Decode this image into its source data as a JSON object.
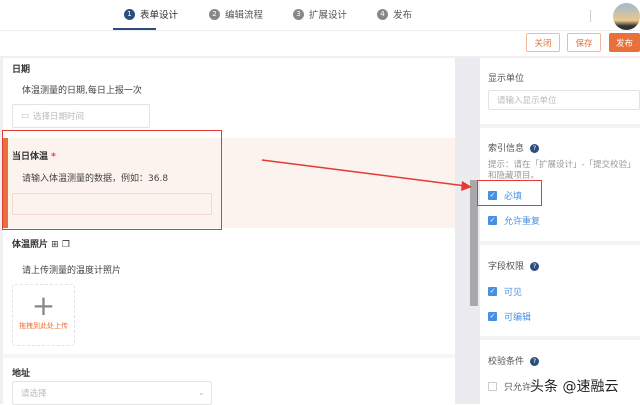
{
  "steps": [
    {
      "n": "1",
      "label": "表单设计"
    },
    {
      "n": "2",
      "label": "编辑流程"
    },
    {
      "n": "3",
      "label": "扩展设计"
    },
    {
      "n": "4",
      "label": "发布"
    }
  ],
  "toolbar": {
    "close": "关闭",
    "save": "保存",
    "publish": "发布"
  },
  "form": {
    "date": {
      "label": "日期",
      "desc": "体温测量的日期,每日上报一次",
      "placeholder": "选择日期时间"
    },
    "temp": {
      "label": "当日体温",
      "required": "*",
      "desc": "请输入体温测量的数据，例如：36.8"
    },
    "photo": {
      "label": "体温照片",
      "desc": "请上传测量的温度计照片",
      "upload": "拖拽到此处上传"
    },
    "address": {
      "label": "地址",
      "placeholder": "请选择"
    }
  },
  "props": {
    "unit": {
      "label": "显示单位",
      "placeholder": "请输入显示单位"
    },
    "index": {
      "label": "索引信息",
      "hint1": "提示：请在「扩展设计」-「提交校验」",
      "hint2": "和隐藏项目。",
      "required": "必填",
      "allow_dup": "允许重复"
    },
    "perm": {
      "label": "字段权限",
      "visible": "可见",
      "editable": "可编辑"
    },
    "validate": {
      "label": "校验条件",
      "only": "只允许"
    }
  },
  "watermark": "头条 @速融云",
  "colors": {
    "accent": "#e8703a",
    "primary": "#2b4e7e",
    "check": "#4a90e2",
    "annot": "#e53935"
  }
}
